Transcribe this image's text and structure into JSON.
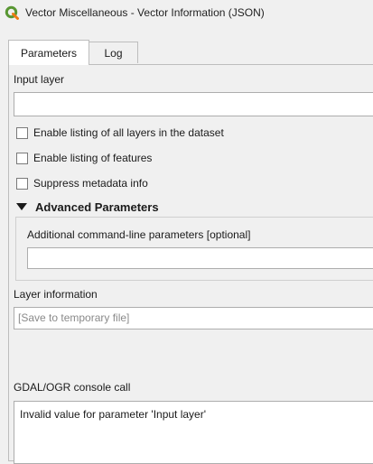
{
  "window": {
    "title": "Vector Miscellaneous - Vector Information (JSON)",
    "logo_icon": "qgis-logo-icon",
    "logo_color": "#589632"
  },
  "tabs": [
    {
      "label": "Parameters",
      "active": true
    },
    {
      "label": "Log",
      "active": false
    }
  ],
  "form": {
    "input_layer_label": "Input layer",
    "input_layer_value": "",
    "checkboxes": [
      {
        "label": "Enable listing of all layers in the dataset",
        "checked": false
      },
      {
        "label": "Enable listing of features",
        "checked": false
      },
      {
        "label": "Suppress metadata info",
        "checked": false
      }
    ],
    "advanced": {
      "header": "Advanced Parameters",
      "expanded": true,
      "additional_label": "Additional command-line parameters [optional]",
      "additional_value": ""
    },
    "layer_info_label": "Layer information",
    "layer_info_placeholder": "[Save to temporary file]",
    "console_label": "GDAL/OGR console call",
    "console_text": "Invalid value for parameter 'Input layer'"
  }
}
